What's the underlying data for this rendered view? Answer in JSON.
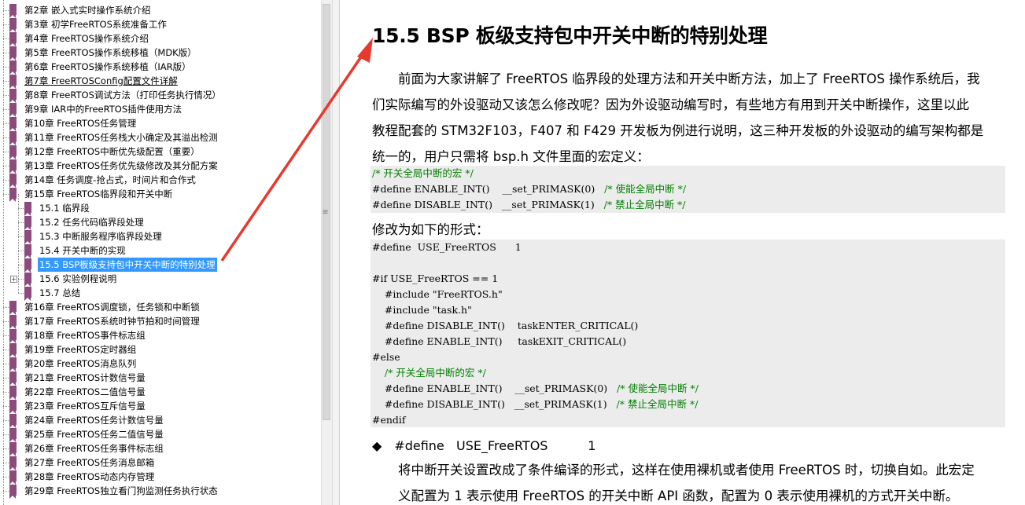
{
  "sidebar": {
    "top_items": [
      {
        "label": "第2章 嵌入式实时操作系统介绍"
      },
      {
        "label": "第3章 初学FreeRTOS系统准备工作"
      },
      {
        "label": "第4章 FreeRTOS操作系统介绍"
      },
      {
        "label": "第5章 FreeRTOS操作系统移植（MDK版）"
      },
      {
        "label": "第6章 FreeRTOS操作系统移植（IAR版）"
      },
      {
        "label": "第7章 FreeRTOSConfig配置文件详解"
      },
      {
        "label": "第8章 FreeRTOS调试方法（打印任务执行情况）"
      },
      {
        "label": "第9章 IAR中的FreeRTOS插件使用方法"
      },
      {
        "label": "第10章 FreeRTOS任务管理"
      },
      {
        "label": "第11章 FreeRTOS任务栈大小确定及其溢出检测"
      },
      {
        "label": "第12章 FreeRTOS中断优先级配置（重要）"
      },
      {
        "label": "第13章 FreeRTOS任务优先级修改及其分配方案"
      },
      {
        "label": "第14章 任务调度-抢占式，时间片和合作式"
      },
      {
        "label": "第15章 FreeRTOS临界段和开关中断"
      }
    ],
    "sub_items": [
      {
        "label": "15.1 临界段"
      },
      {
        "label": "15.2 任务代码临界段处理"
      },
      {
        "label": "15.3 中断服务程序临界段处理"
      },
      {
        "label": "15.4 开关中断的实现"
      },
      {
        "label": "15.5 BSP板级支持包中开关中断的特别处理"
      },
      {
        "label": "15.6 实验例程说明"
      },
      {
        "label": "15.7 总结"
      }
    ],
    "bottom_items": [
      {
        "label": "第16章 FreeRTOS调度锁，任务锁和中断锁"
      },
      {
        "label": "第17章 FreeRTOS系统时钟节拍和时间管理"
      },
      {
        "label": "第18章 FreeRTOS事件标志组"
      },
      {
        "label": "第19章 FreeRTOS定时器组"
      },
      {
        "label": "第20章 FreeRTOS消息队列"
      },
      {
        "label": "第21章 FreeRTOS计数信号量"
      },
      {
        "label": "第22章 FreeRTOS二值信号量"
      },
      {
        "label": "第23章 FreeRTOS互斥信号量"
      },
      {
        "label": "第24章 FreeRTOS任务计数信号量"
      },
      {
        "label": "第25章 FreeRTOS任务二值信号量"
      },
      {
        "label": "第26章 FreeRTOS任务事件标志组"
      },
      {
        "label": "第27章 FreeRTOS任务消息邮箱"
      },
      {
        "label": "第28章 FreeRTOS动态内存管理"
      },
      {
        "label": "第29章 FreeRTOS独立看门狗监测任务执行状态"
      }
    ],
    "splitter_grip": "≡",
    "expander_glyph": "+"
  },
  "content": {
    "heading": "15.5 BSP 板级支持包中开关中断的特别处理",
    "para1": [
      "　　前面为大家讲解了 FreeRTOS 临界段的处理方法和开关中断方法，加上了 FreeRTOS 操作系统后，我",
      "们实际编写的外设驱动又该怎么修改呢？因为外设驱动编写时，有些地方有用到开关中断操作，这里以此",
      "教程配套的 STM32F103，F407 和 F429 开发板为例进行说明，这三种开发板的外设驱动的编写架构都是",
      "统一的，用户只需将 bsp.h 文件里面的宏定义："
    ],
    "code1": [
      {
        "code": "",
        "comment": "/* 开关全局中断的宏 */"
      },
      {
        "code": "#define ENABLE_INT()    __set_PRIMASK(0)   ",
        "comment": "/* 使能全局中断 */"
      },
      {
        "code": "#define DISABLE_INT()   __set_PRIMASK(1)   ",
        "comment": "/* 禁止全局中断 */"
      }
    ],
    "para2": "修改为如下的形式：",
    "code2": [
      {
        "code": "#define  USE_FreeRTOS      1",
        "comment": ""
      },
      {
        "code": "",
        "comment": ""
      },
      {
        "code": "#if USE_FreeRTOS == 1",
        "comment": ""
      },
      {
        "code": "    #include \"FreeRTOS.h\"",
        "comment": ""
      },
      {
        "code": "    #include \"task.h\"",
        "comment": ""
      },
      {
        "code": "    #define DISABLE_INT()    taskENTER_CRITICAL()",
        "comment": ""
      },
      {
        "code": "    #define ENABLE_INT()     taskEXIT_CRITICAL()",
        "comment": ""
      },
      {
        "code": "#else",
        "comment": ""
      },
      {
        "code": "    ",
        "comment": "/* 开关全局中断的宏 */"
      },
      {
        "code": "    #define ENABLE_INT()    __set_PRIMASK(0)   ",
        "comment": "/* 使能全局中断 */"
      },
      {
        "code": "    #define DISABLE_INT()   __set_PRIMASK(1)   ",
        "comment": "/* 禁止全局中断 */"
      },
      {
        "code": "#endif",
        "comment": ""
      }
    ],
    "bullet": "◆　#define   USE_FreeRTOS          1",
    "para3": [
      "　　将中断开关设置改成了条件编译的形式，这样在使用裸机或者使用 FreeRTOS 时，切换自如。此宏定",
      "　　义配置为 1 表示使用 FreeRTOS 的开关中断 API 函数，配置为 0 表示使用裸机的方式开关中断。"
    ]
  },
  "colors": {
    "selection": "#3399ff",
    "bookmark": "#8d4a7d",
    "comment": "#008000",
    "code_bg": "#ececec",
    "arrow": "#e8392f"
  }
}
